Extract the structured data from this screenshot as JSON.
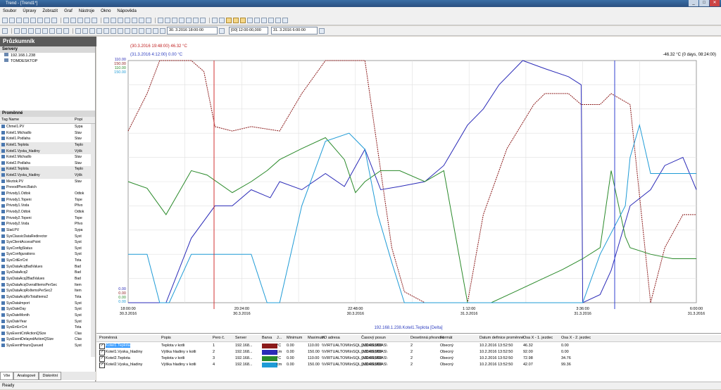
{
  "window": {
    "title": "Trend - [Trend1*]"
  },
  "menu": [
    "Soubor",
    "Úpravy",
    "Zobrazit",
    "Graf",
    "Nástroje",
    "Okno",
    "Nápověda"
  ],
  "toolbar2": {
    "start_date": "30. 3.2016 18:00:00",
    "interval": "[00] 12:00:00,000",
    "end_date": "31. 3.2016 6:00:00"
  },
  "explorer": {
    "title": "Průzkumník",
    "servers_header": "Servery",
    "servers": [
      "192.168.1.238",
      "TOMDESKTOP"
    ],
    "variables_header": "Proměnné",
    "columns": [
      "Tag Name",
      "Popi"
    ],
    "variables": [
      [
        "Chmel1.PV",
        "Sypa"
      ],
      [
        "Kotel1.Michadlo",
        "Stav"
      ],
      [
        "Kotel1.Podlaha",
        "Stav"
      ],
      [
        "Kotel1.Teplota",
        "Teplo"
      ],
      [
        "Kotel1.Vyska_hladiny",
        "Výšk"
      ],
      [
        "Kotel2.Michadlo",
        "Stav"
      ],
      [
        "Kotel2.Podlaha",
        "Stav"
      ],
      [
        "Kotel2.Teplota",
        "Teplo"
      ],
      [
        "Kotel2.Vyska_hladiny",
        "Výšk"
      ],
      [
        "Meztok.PV",
        "Stav"
      ],
      [
        "PrevodPheni.Batch",
        ""
      ],
      [
        "Privody1.Odtok",
        "Odtok"
      ],
      [
        "Privody1.Topeni",
        "Tope"
      ],
      [
        "Privody1.Voda",
        "Přivo"
      ],
      [
        "Privody2.Odtok",
        "Odtok"
      ],
      [
        "Privody2.Topeni",
        "Tope"
      ],
      [
        "Privody2.Voda",
        "Přivo"
      ],
      [
        "Slad.PV",
        "Sypa"
      ],
      [
        "SysClassicDataRedirector",
        "Syst"
      ],
      [
        "SysClientAccessPoint",
        "Syst"
      ],
      [
        "SysConfigStatus",
        "Syst"
      ],
      [
        "SysConfigurations",
        "Syst"
      ],
      [
        "SysCritErrCnt",
        "Tota"
      ],
      [
        "SysDataAcqBadValues",
        "Bad"
      ],
      [
        "SysDataAcq2",
        "Bad"
      ],
      [
        "SysDataAcq2BadValues",
        "Bad"
      ],
      [
        "SysDataAcqOverallItemsPerSec",
        "Item"
      ],
      [
        "SysDataAcqRxItemsPerSec2",
        "Item"
      ],
      [
        "SysDataAcqRxTotalItems2",
        "Tota"
      ],
      [
        "SysDataImport",
        "Syst"
      ],
      [
        "SysDateDay",
        "Syst"
      ],
      [
        "SysDateMonth",
        "Syst"
      ],
      [
        "SysDateYear",
        "Syst"
      ],
      [
        "SysErrErrCnt",
        "Tota"
      ],
      [
        "SysEventCritActionQSize",
        "Clas"
      ],
      [
        "SysEventDelayedActionQSize",
        "Clas"
      ],
      [
        "SysEventHoursQueued",
        "Syst"
      ]
    ],
    "tabs": [
      "Vše",
      "Analogové",
      "Diskrétní"
    ]
  },
  "chart": {
    "cursor1_label": "(30.3.2016 19:48:00) 46.32 °C",
    "cursor2_label": "(31.3.2016 4:12:00) 0.00 °C",
    "delta_label": "-46.32 °C (0 days, 08:24:00)",
    "bottom_label": "192.168.1.238.Kotel1.Teplota [Delta]",
    "x_ticks": [
      [
        "18:00:00",
        "30.3.2016"
      ],
      [
        "20:24:00",
        "30.3.2016"
      ],
      [
        "22:48:00",
        "30.3.2016"
      ],
      [
        "1:12:00",
        "31.3.2016"
      ],
      [
        "3:36:00",
        "31.3.2016"
      ],
      [
        "6:00:00",
        "31.3.2016"
      ]
    ],
    "y_top_labels": [
      "110.00",
      "150.00",
      "110.00",
      "150.00"
    ],
    "y_bottom_labels": [
      "0.00",
      "0.00",
      "0.00",
      "0.00"
    ]
  },
  "chart_data": {
    "type": "line",
    "x_range": [
      "2016-03-30 18:00",
      "2016-03-31 06:00"
    ],
    "series": [
      {
        "name": "Kotel1.Teplota",
        "color": "#8b1a1a",
        "x": [
          "18:00",
          "18:24",
          "18:40",
          "18:52",
          "19:20",
          "19:36",
          "19:50",
          "20:12",
          "20:36",
          "21:12",
          "21:40",
          "22:10",
          "22:40",
          "23:00",
          "23:16",
          "23:34",
          "23:50",
          "0:16",
          "0:40",
          "1:10",
          "1:30",
          "2:00",
          "2:34",
          "2:48",
          "3:18",
          "3:34",
          "3:58",
          "4:12",
          "4:36",
          "5:02",
          "5:20",
          "5:43",
          "6:00"
        ],
        "values": [
          78,
          95,
          125,
          150,
          150,
          105,
          80,
          78,
          80,
          78,
          95,
          145,
          150,
          120,
          70,
          25,
          5,
          0,
          0,
          0,
          40,
          70,
          90,
          95,
          95,
          90,
          90,
          95,
          90,
          0,
          25,
          40,
          40
        ]
      },
      {
        "name": "Kotel1.Vyska_hladiny",
        "color": "#2b2bb8",
        "x": [
          "18:00",
          "18:48",
          "19:20",
          "19:50",
          "20:12",
          "20:36",
          "21:00",
          "21:12",
          "21:40",
          "22:10",
          "22:34",
          "23:00",
          "23:20",
          "23:44",
          "0:16",
          "0:40",
          "1:10",
          "1:30",
          "1:50",
          "2:20",
          "2:48",
          "3:18",
          "3:34",
          "3:36",
          "3:58",
          "4:12",
          "4:36",
          "5:02",
          "5:20",
          "5:43",
          "6:00"
        ],
        "values": [
          0,
          0,
          40,
          60,
          60,
          70,
          65,
          75,
          70,
          80,
          72,
          95,
          70,
          72,
          75,
          85,
          110,
          120,
          135,
          150,
          145,
          140,
          135,
          0,
          5,
          20,
          60,
          70,
          85,
          90,
          70
        ]
      },
      {
        "name": "Kotel2.Teplota",
        "color": "#2a8a2a",
        "x": [
          "18:00",
          "18:24",
          "18:48",
          "19:20",
          "19:40",
          "20:12",
          "20:36",
          "20:56",
          "21:12",
          "21:40",
          "22:10",
          "22:34",
          "22:48",
          "23:00",
          "23:20",
          "23:44",
          "0:16",
          "0:40",
          "1:10",
          "1:40",
          "2:10",
          "2:40",
          "3:10",
          "3:36",
          "3:58",
          "4:12",
          "4:30",
          "4:36",
          "5:02",
          "5:30",
          "6:00"
        ],
        "values": [
          55,
          52,
          40,
          60,
          58,
          50,
          55,
          60,
          65,
          70,
          75,
          65,
          50,
          55,
          60,
          60,
          55,
          60,
          0,
          0,
          5,
          10,
          15,
          20,
          25,
          60,
          30,
          25,
          22,
          20,
          20
        ]
      },
      {
        "name": "Kotel2.Vyska_hladiny",
        "color": "#1f9bd6",
        "x": [
          "18:00",
          "18:24",
          "18:40",
          "18:52",
          "19:20",
          "20:12",
          "20:36",
          "20:56",
          "21:12",
          "21:40",
          "22:10",
          "22:40",
          "23:00",
          "23:16",
          "23:34",
          "23:50",
          "0:16",
          "0:40",
          "1:10",
          "1:30",
          "2:00",
          "2:30",
          "2:48",
          "3:18",
          "3:36",
          "3:58",
          "4:30",
          "4:36",
          "4:48",
          "5:02",
          "5:20",
          "5:43",
          "6:00"
        ],
        "values": [
          30,
          30,
          0,
          0,
          30,
          30,
          30,
          0,
          0,
          60,
          100,
          105,
          95,
          55,
          25,
          0,
          0,
          0,
          0,
          0,
          0,
          0,
          0,
          0,
          0,
          30,
          60,
          90,
          110,
          80,
          80,
          80,
          80
        ]
      }
    ]
  },
  "table": {
    "headers": [
      "Proměnná",
      "Popis",
      "Pero č.",
      "Server",
      "Barva",
      "J...",
      "Minimum",
      "Maximum",
      "I/O adresa",
      "Časový posun",
      "Desetinná přesnost",
      "Formát",
      "Datum definice proměnné",
      "Osa X - 1. jezdec",
      "Osa X - 2. jezdec"
    ],
    "rows": [
      {
        "name": "Kotel1.Teplota",
        "desc": "Teplota v kotli",
        "pen": "1",
        "server": "192.168...",
        "color": "#8b1a1a",
        "unit": "°C",
        "min": "0.00",
        "max": "110.00",
        "io": "\\\\VIRTUALTOM\\InSQL_MDASIMDAS\\",
        "shift": "0:00:00,000",
        "prec": "2",
        "fmt": "Obecný",
        "date": "10.2.2016 13:52:50",
        "x1": "46.32",
        "x2": "0.00"
      },
      {
        "name": "Kotel1.Vyska_hladiny",
        "desc": "Výška hladiny v kotli",
        "pen": "2",
        "server": "192.168...",
        "color": "#2b2bb8",
        "unit": "cm",
        "min": "0.00",
        "max": "150.00",
        "io": "\\\\VIRTUALTOM\\InSQL_MDASIMDAS\\",
        "shift": "0:00:00,000",
        "prec": "2",
        "fmt": "Obecný",
        "date": "10.2.2016 13:52:50",
        "x1": "92.00",
        "x2": "0.00"
      },
      {
        "name": "Kotel2.Teplota",
        "desc": "Teplota v kotli",
        "pen": "3",
        "server": "192.168...",
        "color": "#2a8a2a",
        "unit": "°C",
        "min": "0.00",
        "max": "110.00",
        "io": "\\\\VIRTUALTOM\\InSQL_MDASIMDAS\\",
        "shift": "0:00:00,000",
        "prec": "2",
        "fmt": "Obecný",
        "date": "10.2.2016 13:52:50",
        "x1": "72.98",
        "x2": "34.76"
      },
      {
        "name": "Kotel2.Vyska_hladiny",
        "desc": "Výška hladiny v kotli",
        "pen": "4",
        "server": "192.168...",
        "color": "#1f9bd6",
        "unit": "cm",
        "min": "0.00",
        "max": "150.00",
        "io": "\\\\VIRTUALTOM\\InSQL_MDASIMDAS\\",
        "shift": "0:00:00,000",
        "prec": "2",
        "fmt": "Obecný",
        "date": "10.2.2016 13:52:50",
        "x1": "42.07",
        "x2": "99.36"
      }
    ]
  },
  "status": "Ready"
}
